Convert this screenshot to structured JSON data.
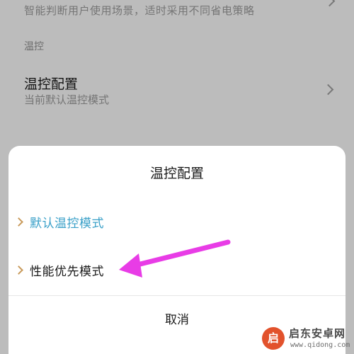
{
  "background": {
    "power_row": {
      "description": "智能判断用户使用场景，适时采用不同省电策略"
    },
    "section_label": "温控",
    "thermal_row": {
      "title": "温控配置",
      "subtitle": "当前默认温控模式"
    }
  },
  "dialog": {
    "title": "温控配置",
    "options": [
      {
        "label": "默认温控模式",
        "color": "#3aa0c8"
      },
      {
        "label": "性能优先模式",
        "color": "#1a1a1a"
      }
    ],
    "cancel_label": "取消"
  },
  "annotation": {
    "arrow_color": "#e83ce6"
  },
  "watermark": {
    "name": "启东安卓网",
    "url": "www.qidong.com",
    "logo_glyph": "启"
  }
}
